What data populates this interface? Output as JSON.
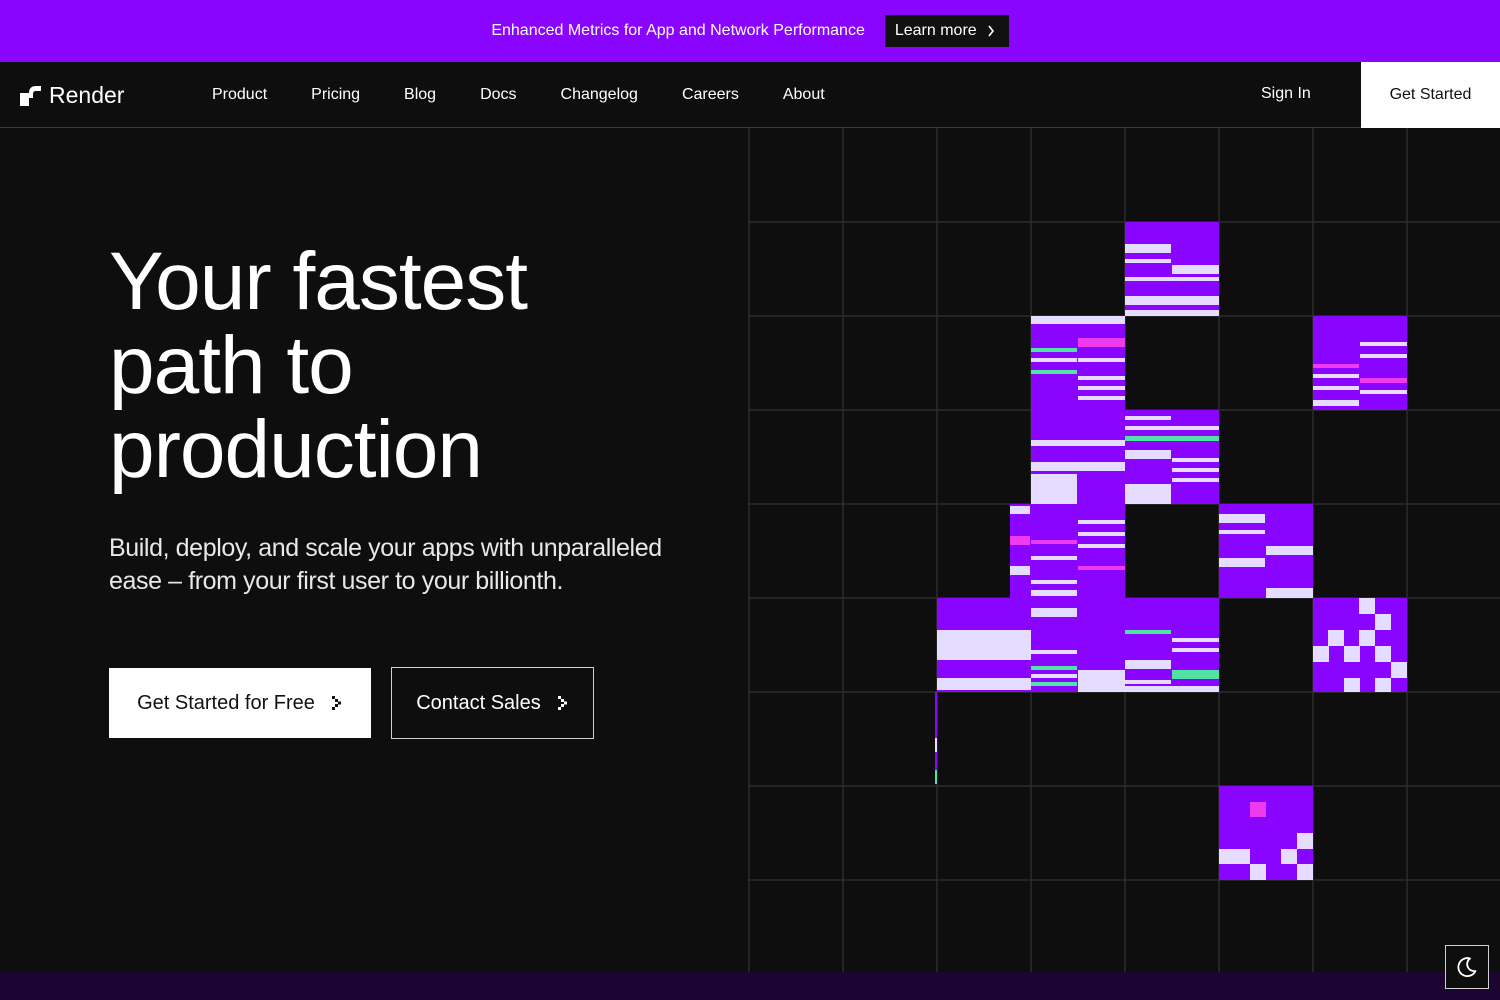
{
  "banner": {
    "text": "Enhanced Metrics for App and Network Performance",
    "link_label": "Learn more",
    "color": "#8a05ff"
  },
  "nav": {
    "brand": "Render",
    "links": [
      "Product",
      "Pricing",
      "Blog",
      "Docs",
      "Changelog",
      "Careers",
      "About"
    ],
    "sign_in": "Sign In",
    "cta": "Get Started"
  },
  "hero": {
    "headline_lines": [
      "Your fastest",
      "path to",
      "production"
    ],
    "subtext_lines": [
      "Build, deploy, and scale your apps with unparalleled",
      "ease – from your first user to your billionth."
    ],
    "primary_cta": "Get Started for Free",
    "secondary_cta": "Contact Sales"
  },
  "icons": {
    "logo": "render-logo-icon",
    "banner_arrow": "chevron-right-icon",
    "cta_arrow": "pixel-arrow-right-icon",
    "theme": "moon-icon"
  },
  "colors": {
    "accent": "#8a05ff",
    "lavender": "#e5dcff",
    "magenta": "#ee3bf0",
    "mint": "#50e3a4",
    "background": "#0e0e0e"
  }
}
